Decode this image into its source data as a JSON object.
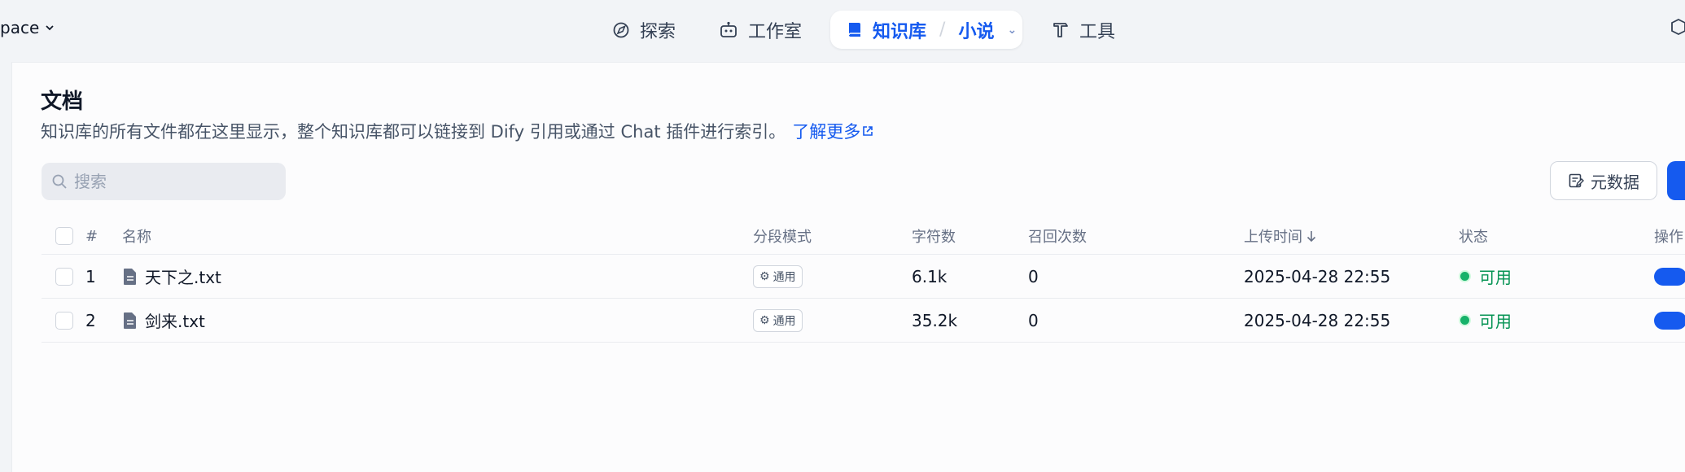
{
  "topbar": {
    "workspace_label": "pace",
    "nav": {
      "explore": "探索",
      "studio": "工作室",
      "knowledge": "知识库",
      "knowledge_current": "小说",
      "tools": "工具"
    }
  },
  "page": {
    "title": "文档",
    "description": "知识库的所有文件都在这里显示，整个知识库都可以链接到 Dify 引用或通过 Chat 插件进行索引。",
    "learn_more": "了解更多"
  },
  "search": {
    "placeholder": "搜索",
    "value": ""
  },
  "toolbar": {
    "metadata_label": "元数据"
  },
  "table": {
    "headers": {
      "index": "#",
      "name": "名称",
      "mode": "分段模式",
      "chars": "字符数",
      "hits": "召回次数",
      "upload_time": "上传时间",
      "status": "状态",
      "actions": "操作"
    },
    "rows": [
      {
        "index": "1",
        "name": "天下之.txt",
        "mode": "通用",
        "chars": "6.1k",
        "hits": "0",
        "upload_time": "2025-04-28 22:55",
        "status": "可用",
        "enabled": true
      },
      {
        "index": "2",
        "name": "剑来.txt",
        "mode": "通用",
        "chars": "35.2k",
        "hits": "0",
        "upload_time": "2025-04-28 22:55",
        "status": "可用",
        "enabled": true
      }
    ]
  },
  "colors": {
    "accent": "#155aef",
    "status_ok": "#079455",
    "background": "#f2f4f7"
  }
}
